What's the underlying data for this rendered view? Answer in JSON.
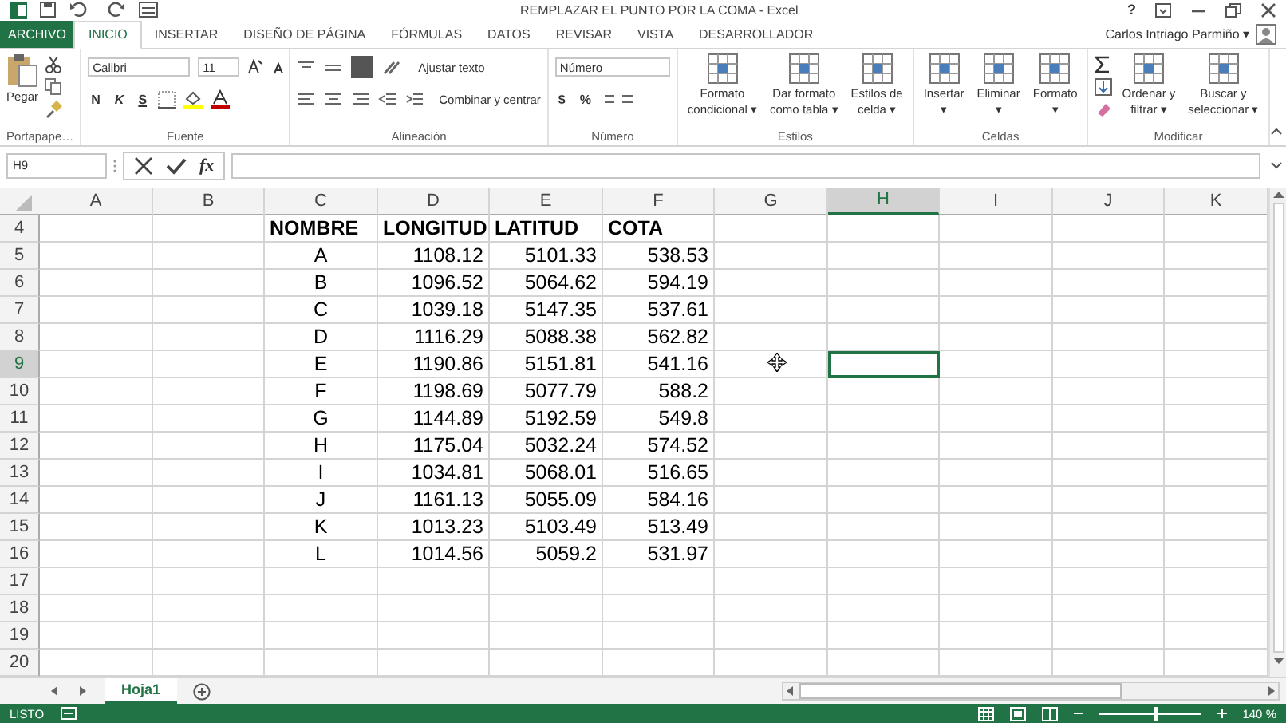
{
  "window": {
    "title": "REMPLAZAR EL PUNTO POR LA COMA - Excel",
    "help": "?",
    "user": "Carlos Intriago Parmiño ▾"
  },
  "tabs": [
    {
      "label": "ARCHIVO",
      "kind": "file",
      "selected": false
    },
    {
      "label": "INICIO",
      "kind": "tab",
      "selected": true
    },
    {
      "label": "INSERTAR",
      "kind": "tab",
      "selected": false
    },
    {
      "label": "DISEÑO DE PÁGINA",
      "kind": "tab",
      "selected": false
    },
    {
      "label": "FÓRMULAS",
      "kind": "tab",
      "selected": false
    },
    {
      "label": "DATOS",
      "kind": "tab",
      "selected": false
    },
    {
      "label": "REVISAR",
      "kind": "tab",
      "selected": false
    },
    {
      "label": "VISTA",
      "kind": "tab",
      "selected": false
    },
    {
      "label": "DESARROLLADOR",
      "kind": "tab",
      "selected": false
    }
  ],
  "ribbon": [
    {
      "label": "Portapape…",
      "kind": "clipboard",
      "paste": "Pegar"
    },
    {
      "label": "Fuente",
      "kind": "font",
      "font": "Calibri",
      "size": "11",
      "styles": [
        "N",
        "K",
        "S"
      ]
    },
    {
      "label": "Alineación",
      "kind": "alignment",
      "wrap": "Ajustar texto",
      "merge": "Combinar y centrar"
    },
    {
      "label": "Número",
      "kind": "number",
      "format": "Número",
      "currency": "$",
      "percent": "%"
    },
    {
      "label": "Estilos",
      "kind": "buttons",
      "buttons": [
        {
          "lines": [
            "Formato",
            "condicional ▾"
          ]
        },
        {
          "lines": [
            "Dar formato",
            "como tabla ▾"
          ]
        },
        {
          "lines": [
            "Estilos de",
            "celda ▾"
          ]
        }
      ]
    },
    {
      "label": "Celdas",
      "kind": "buttons",
      "buttons": [
        {
          "lines": [
            "Insertar",
            "▾"
          ]
        },
        {
          "lines": [
            "Eliminar",
            "▾"
          ]
        },
        {
          "lines": [
            "Formato",
            "▾"
          ]
        }
      ]
    },
    {
      "label": "Modificar",
      "kind": "editing",
      "buttons": [
        {
          "lines": [
            "Ordenar y",
            "filtrar ▾"
          ]
        },
        {
          "lines": [
            "Buscar y",
            "seleccionar ▾"
          ]
        }
      ]
    }
  ],
  "formula_bar": {
    "name_box": "H9",
    "fx": "fx"
  },
  "sheet": {
    "columns": [
      {
        "label": "A",
        "selected": false
      },
      {
        "label": "B",
        "selected": false
      },
      {
        "label": "C",
        "selected": false
      },
      {
        "label": "D",
        "selected": false
      },
      {
        "label": "E",
        "selected": false
      },
      {
        "label": "F",
        "selected": false
      },
      {
        "label": "G",
        "selected": false
      },
      {
        "label": "H",
        "selected": true
      },
      {
        "label": "I",
        "selected": false
      },
      {
        "label": "J",
        "selected": false
      },
      {
        "label": "K",
        "selected": false
      }
    ],
    "rows": [
      {
        "number": "4",
        "kind": "header",
        "selected": false,
        "values": [
          "NOMBRE",
          "LONGITUD",
          "LATITUD",
          "COTA"
        ]
      },
      {
        "number": "5",
        "kind": "data",
        "selected": false,
        "values": [
          "A",
          "1108.12",
          "5101.33",
          "538.53"
        ]
      },
      {
        "number": "6",
        "kind": "data",
        "selected": false,
        "values": [
          "B",
          "1096.52",
          "5064.62",
          "594.19"
        ]
      },
      {
        "number": "7",
        "kind": "data",
        "selected": false,
        "values": [
          "C",
          "1039.18",
          "5147.35",
          "537.61"
        ]
      },
      {
        "number": "8",
        "kind": "data",
        "selected": false,
        "values": [
          "D",
          "1116.29",
          "5088.38",
          "562.82"
        ]
      },
      {
        "number": "9",
        "kind": "data",
        "selected": true,
        "values": [
          "E",
          "1190.86",
          "5151.81",
          "541.16"
        ]
      },
      {
        "number": "10",
        "kind": "data",
        "selected": false,
        "values": [
          "F",
          "1198.69",
          "5077.79",
          "588.2"
        ]
      },
      {
        "number": "11",
        "kind": "data",
        "selected": false,
        "values": [
          "G",
          "1144.89",
          "5192.59",
          "549.8"
        ]
      },
      {
        "number": "12",
        "kind": "data",
        "selected": false,
        "values": [
          "H",
          "1175.04",
          "5032.24",
          "574.52"
        ]
      },
      {
        "number": "13",
        "kind": "data",
        "selected": false,
        "values": [
          "I",
          "1034.81",
          "5068.01",
          "516.65"
        ]
      },
      {
        "number": "14",
        "kind": "data",
        "selected": false,
        "values": [
          "J",
          "1161.13",
          "5055.09",
          "584.16"
        ]
      },
      {
        "number": "15",
        "kind": "data",
        "selected": false,
        "values": [
          "K",
          "1013.23",
          "5103.49",
          "513.49"
        ]
      },
      {
        "number": "16",
        "kind": "data",
        "selected": false,
        "values": [
          "L",
          "1014.56",
          "5059.2",
          "531.97"
        ]
      },
      {
        "number": "17",
        "kind": "empty",
        "selected": false
      },
      {
        "number": "18",
        "kind": "empty",
        "selected": false
      },
      {
        "number": "19",
        "kind": "empty",
        "selected": false
      },
      {
        "number": "20",
        "kind": "empty",
        "selected": false
      }
    ]
  },
  "sheet_tabs": [
    {
      "label": "Hoja1",
      "selected": true
    }
  ],
  "status_bar": {
    "status": "LISTO",
    "zoom": {
      "level": 0.55,
      "label": "140 %"
    }
  }
}
